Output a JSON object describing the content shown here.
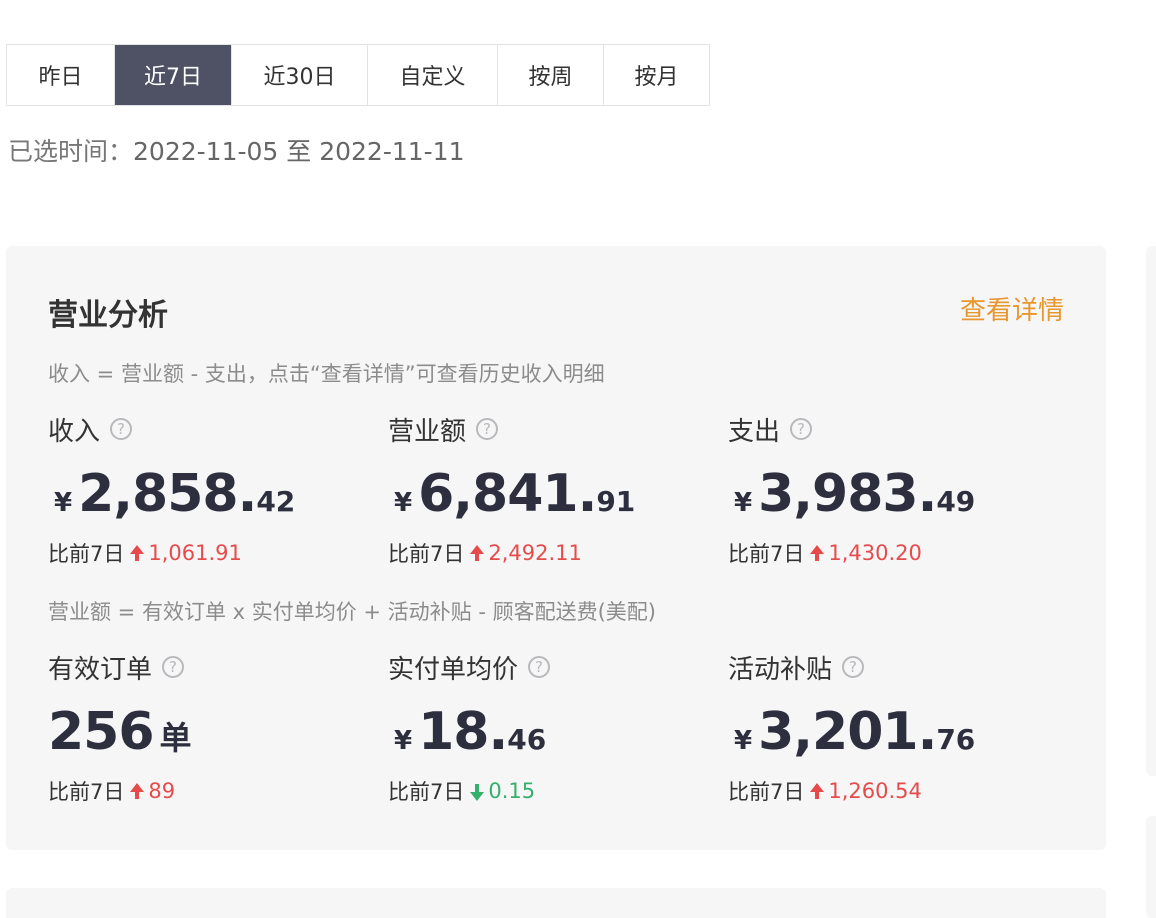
{
  "tabs": [
    {
      "label": "昨日",
      "active": false
    },
    {
      "label": "近7日",
      "active": true
    },
    {
      "label": "近30日",
      "active": false
    },
    {
      "label": "自定义",
      "active": false
    },
    {
      "label": "按周",
      "active": false
    },
    {
      "label": "按月",
      "active": false
    }
  ],
  "selected_range": {
    "prefix": "已选时间：",
    "text": "2022-11-05 至 2022-11-11"
  },
  "card": {
    "title": "营业分析",
    "details_link": "查看详情",
    "formula1": "收入 = 营业额 - 支出，点击“查看详情”可查看历史收入明细",
    "formula2": "营业额 = 有效订单 x 实付单均价 + 活动补贴 - 顾客配送费(美配)",
    "help_icon": "?",
    "metrics": {
      "income": {
        "label": "收入",
        "currency": "¥",
        "int": "2,858.",
        "dec": "42",
        "compare_label": "比前7日",
        "direction": "up",
        "delta": "1,061.91"
      },
      "revenue": {
        "label": "营业额",
        "currency": "¥",
        "int": "6,841.",
        "dec": "91",
        "compare_label": "比前7日",
        "direction": "up",
        "delta": "2,492.11"
      },
      "expense": {
        "label": "支出",
        "currency": "¥",
        "int": "3,983.",
        "dec": "49",
        "compare_label": "比前7日",
        "direction": "up",
        "delta": "1,430.20"
      },
      "orders": {
        "label": "有效订单",
        "int": "256",
        "unit": "单",
        "compare_label": "比前7日",
        "direction": "up",
        "delta": "89"
      },
      "avg_price": {
        "label": "实付单均价",
        "currency": "¥",
        "int": "18.",
        "dec": "46",
        "compare_label": "比前7日",
        "direction": "down",
        "delta": "0.15"
      },
      "subsidy": {
        "label": "活动补贴",
        "currency": "¥",
        "int": "3,201.",
        "dec": "76",
        "compare_label": "比前7日",
        "direction": "up",
        "delta": "1,260.54"
      }
    }
  },
  "colors": {
    "accent_orange": "#e8962e",
    "tab_active_bg": "#4e5264",
    "up_red": "#e64b4b",
    "down_green": "#35b06a",
    "card_bg": "#f6f6f7"
  }
}
